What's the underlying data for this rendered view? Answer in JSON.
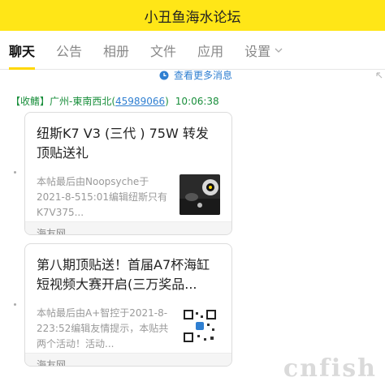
{
  "window": {
    "title": "小丑鱼海水论坛"
  },
  "tabs": [
    {
      "label": "聊天",
      "active": true
    },
    {
      "label": "公告",
      "active": false
    },
    {
      "label": "相册",
      "active": false
    },
    {
      "label": "文件",
      "active": false
    },
    {
      "label": "应用",
      "active": false
    },
    {
      "label": "设置",
      "active": false,
      "has_dropdown": true
    }
  ],
  "history": {
    "label": "查看更多消息",
    "icon": "clock-icon"
  },
  "message": {
    "sender_tag": "【收鳍】",
    "sender_name": "广州-東南西北(",
    "sender_qq": "45989066",
    "sender_close": ")",
    "time": "10:06:38"
  },
  "cards": [
    {
      "title": "纽斯K7 V3 (三代 ) 75W 转发顶贴送礼",
      "desc": "本帖最后由Noopsyche于2021-8-515:01编辑纽斯只有K7V375...",
      "source": "海友网"
    },
    {
      "title": "第八期顶贴送！首届A7杯海缸短视频大赛开启(三万奖品...",
      "desc": "本帖最后由A+智控于2021-8-223:52编辑友情提示，本贴共两个活动！活动...",
      "source": "海友网"
    }
  ],
  "watermark": {
    "text": "cnfish"
  },
  "colors": {
    "title_bar": "#ffe617",
    "accent_tab": "#ffd700",
    "sender": "#1a8f3c",
    "link": "#2f7fd1"
  }
}
